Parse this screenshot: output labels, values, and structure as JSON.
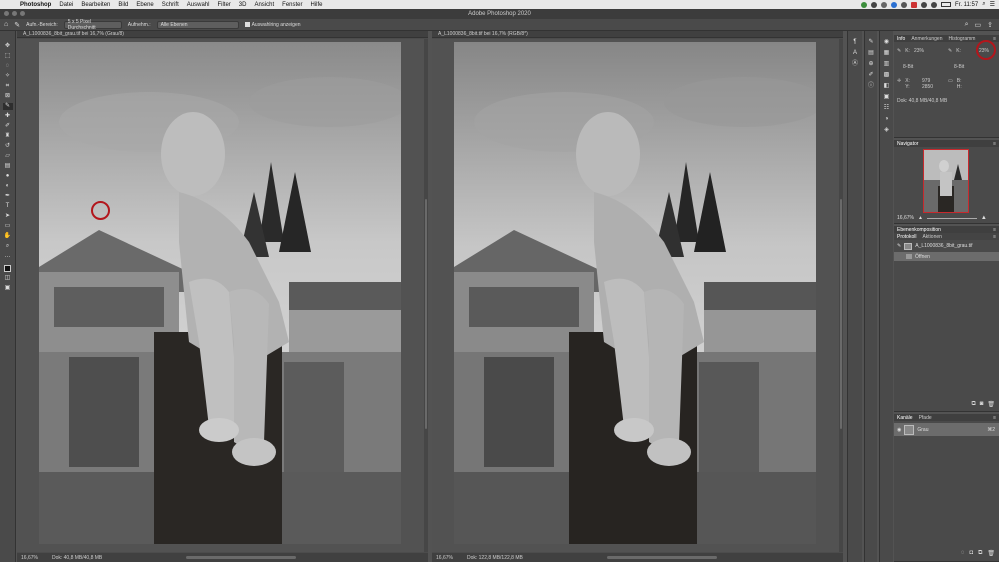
{
  "menubar": {
    "apple": "",
    "items": [
      "Photoshop",
      "Datei",
      "Bearbeiten",
      "Bild",
      "Ebene",
      "Schrift",
      "Auswahl",
      "Filter",
      "3D",
      "Ansicht",
      "Fenster",
      "Hilfe"
    ],
    "clock": "Fr. 11:57"
  },
  "window": {
    "title": "Adobe Photoshop 2020"
  },
  "options": {
    "sample_label": "Aufn.-Bereich:",
    "sample_value": "5 x 5 Pixel Durchschnitt",
    "sample_layers_label": "Aufnehm.:",
    "sample_layers_value": "Alle Ebenen",
    "show_ring_label": "Auswahlring anzeigen"
  },
  "doc_left": {
    "tab": "A_L1000836_8bit_grau.tif bei 16,7% (Grau/8)",
    "zoom": "16,67%",
    "size": "Dok: 40,8 MB/40,8 MB"
  },
  "doc_right": {
    "tab": "A_L1000836_8bit.tif bei 16,7% (RGB/8*)",
    "zoom": "16,67%",
    "size": "Dok: 122,8 MB/122,8 MB"
  },
  "info_panel": {
    "tabs": [
      "Info",
      "Anmerkungen",
      "Histogramm"
    ],
    "k_label_1": "K:",
    "k_value_1": "23%",
    "k_label_2": "K:",
    "k_value_2": "23%",
    "bit_1": "8-Bit",
    "bit_2": "8-Bit",
    "x_label": "X:",
    "y_label": "Y:",
    "x_value": "979",
    "y_value": "2850",
    "b_label": "B:",
    "h_label": "H:",
    "doc_size": "Dok: 40,8 MB/40,8 MB"
  },
  "navigator": {
    "title": "Navigator",
    "zoom": "16,67%"
  },
  "comps": {
    "title": "Ebenenkomposition",
    "tabs": [
      "Protokoll",
      "Aktionen"
    ],
    "file": "A_L1000836_8bit_grau.tif",
    "step": "Öffnen"
  },
  "channels": {
    "tabs": [
      "Kanäle",
      "Pfade"
    ],
    "channel_name": "Grau",
    "shortcut": "⌘2"
  },
  "colors": {
    "highlight_ring": "#b3161c",
    "panel_bg": "#4a4a4a"
  }
}
